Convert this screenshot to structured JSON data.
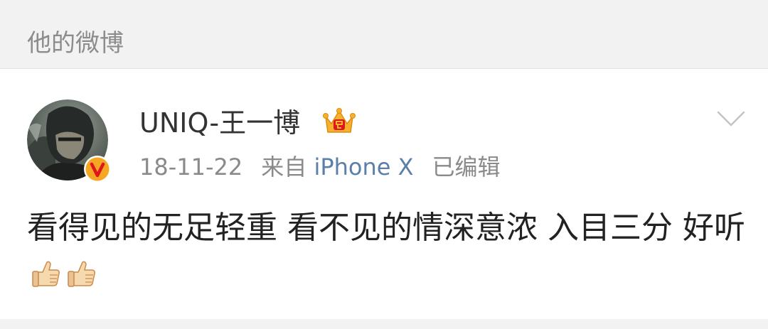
{
  "section": {
    "title": "他的微博"
  },
  "post": {
    "author": {
      "name": "UNIQ-王一博",
      "avatar_icon": "avatar-photo",
      "verified_icon": "verified-badge-icon",
      "member_icon": "crown-icon"
    },
    "meta": {
      "time": "18-11-22",
      "source_prefix": "来自",
      "device": "iPhone X",
      "edited": "已编辑"
    },
    "text": "看得见的无足轻重 看不见的情深意浓 入目三分 好听",
    "emoji": [
      "thumbs-up-icon",
      "thumbs-up-icon"
    ],
    "menu_icon": "chevron-down-icon"
  },
  "colors": {
    "background": "#f2f2f2",
    "card": "#ffffff",
    "header_text": "#8c8c8c",
    "username": "#333333",
    "meta_text": "#8a8a8a",
    "link": "#5b7fa8",
    "verified": "#f5a623",
    "crown": "#f6b22d"
  }
}
